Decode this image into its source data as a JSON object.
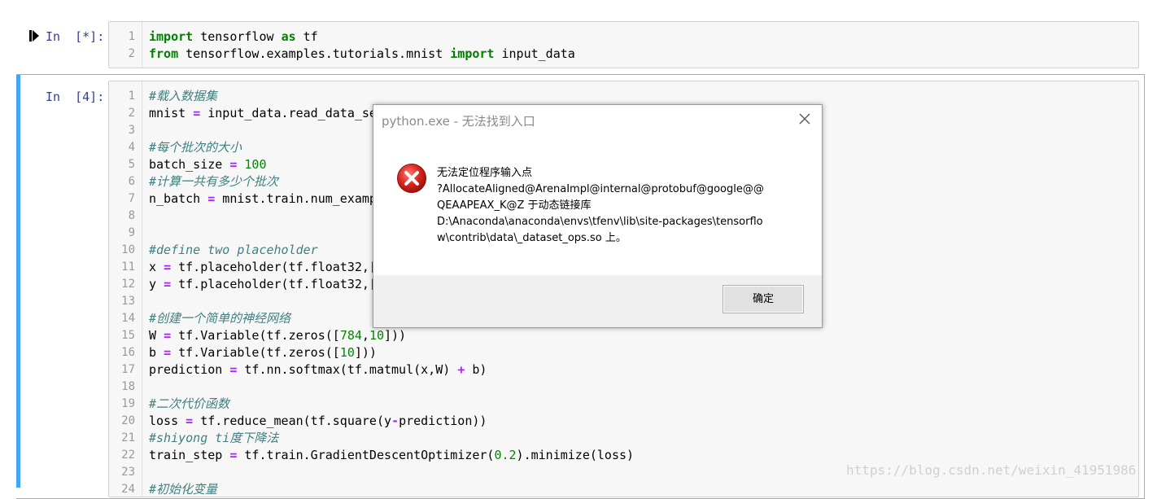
{
  "cell1": {
    "prompt": "In  [*]:",
    "lines": [
      {
        "n": "1",
        "parts": [
          {
            "t": "import",
            "c": "kw"
          },
          {
            "t": " tensorflow ",
            "c": ""
          },
          {
            "t": "as",
            "c": "kw"
          },
          {
            "t": " tf",
            "c": ""
          }
        ]
      },
      {
        "n": "2",
        "parts": [
          {
            "t": "from",
            "c": "kw"
          },
          {
            "t": " tensorflow.examples.tutorials.mnist ",
            "c": ""
          },
          {
            "t": "import",
            "c": "kw"
          },
          {
            "t": " input_data",
            "c": ""
          }
        ]
      }
    ]
  },
  "cell2": {
    "prompt": "In  [4]:",
    "lines": [
      {
        "n": "1",
        "parts": [
          {
            "t": "#载入数据集",
            "c": "cm"
          }
        ]
      },
      {
        "n": "2",
        "parts": [
          {
            "t": "mnist ",
            "c": ""
          },
          {
            "t": "=",
            "c": "op"
          },
          {
            "t": " input_data.read_data_set",
            "c": ""
          }
        ]
      },
      {
        "n": "3",
        "parts": []
      },
      {
        "n": "4",
        "parts": [
          {
            "t": "#每个批次的大小",
            "c": "cm"
          }
        ]
      },
      {
        "n": "5",
        "parts": [
          {
            "t": "batch_size ",
            "c": ""
          },
          {
            "t": "=",
            "c": "op"
          },
          {
            "t": " ",
            "c": ""
          },
          {
            "t": "100",
            "c": "nm"
          }
        ]
      },
      {
        "n": "6",
        "parts": [
          {
            "t": "#计算一共有多少个批次",
            "c": "cm"
          }
        ]
      },
      {
        "n": "7",
        "parts": [
          {
            "t": "n_batch ",
            "c": ""
          },
          {
            "t": "=",
            "c": "op"
          },
          {
            "t": " mnist.train.num_exampl",
            "c": ""
          }
        ]
      },
      {
        "n": "8",
        "parts": []
      },
      {
        "n": "9",
        "parts": []
      },
      {
        "n": "10",
        "parts": [
          {
            "t": "#define two placeholder",
            "c": "cm"
          }
        ]
      },
      {
        "n": "11",
        "parts": [
          {
            "t": "x ",
            "c": ""
          },
          {
            "t": "=",
            "c": "op"
          },
          {
            "t": " tf.placeholder(tf.float32,[N",
            "c": ""
          }
        ]
      },
      {
        "n": "12",
        "parts": [
          {
            "t": "y ",
            "c": ""
          },
          {
            "t": "=",
            "c": "op"
          },
          {
            "t": " tf.placeholder(tf.float32,[N",
            "c": ""
          }
        ]
      },
      {
        "n": "13",
        "parts": []
      },
      {
        "n": "14",
        "parts": [
          {
            "t": "#创建一个简单的神经网络",
            "c": "cm"
          }
        ]
      },
      {
        "n": "15",
        "parts": [
          {
            "t": "W ",
            "c": ""
          },
          {
            "t": "=",
            "c": "op"
          },
          {
            "t": " tf.Variable(tf.zeros([",
            "c": ""
          },
          {
            "t": "784",
            "c": "nm"
          },
          {
            "t": ",",
            "c": ""
          },
          {
            "t": "10",
            "c": "nm"
          },
          {
            "t": "]))",
            "c": ""
          }
        ]
      },
      {
        "n": "16",
        "parts": [
          {
            "t": "b ",
            "c": ""
          },
          {
            "t": "=",
            "c": "op"
          },
          {
            "t": " tf.Variable(tf.zeros([",
            "c": ""
          },
          {
            "t": "10",
            "c": "nm"
          },
          {
            "t": "]))",
            "c": ""
          }
        ]
      },
      {
        "n": "17",
        "parts": [
          {
            "t": "prediction ",
            "c": ""
          },
          {
            "t": "=",
            "c": "op"
          },
          {
            "t": " tf.nn.softmax(tf.matmul(x,W) ",
            "c": ""
          },
          {
            "t": "+",
            "c": "op"
          },
          {
            "t": " b)",
            "c": ""
          }
        ]
      },
      {
        "n": "18",
        "parts": []
      },
      {
        "n": "19",
        "parts": [
          {
            "t": "#二次代价函数",
            "c": "cm"
          }
        ]
      },
      {
        "n": "20",
        "parts": [
          {
            "t": "loss ",
            "c": ""
          },
          {
            "t": "=",
            "c": "op"
          },
          {
            "t": " tf.reduce_mean(tf.square(y",
            "c": ""
          },
          {
            "t": "-",
            "c": "op"
          },
          {
            "t": "prediction))",
            "c": ""
          }
        ]
      },
      {
        "n": "21",
        "parts": [
          {
            "t": "#shiyong ti度下降法",
            "c": "cm"
          }
        ]
      },
      {
        "n": "22",
        "parts": [
          {
            "t": "train_step ",
            "c": ""
          },
          {
            "t": "=",
            "c": "op"
          },
          {
            "t": " tf.train.GradientDescentOptimizer(",
            "c": ""
          },
          {
            "t": "0.2",
            "c": "nm"
          },
          {
            "t": ").minimize(loss)",
            "c": ""
          }
        ]
      },
      {
        "n": "23",
        "parts": []
      },
      {
        "n": "24",
        "parts": [
          {
            "t": "#初始化变量",
            "c": "cm"
          }
        ]
      }
    ]
  },
  "dialog": {
    "title": "python.exe - 无法找到入口",
    "icon": "error-icon",
    "message_lines": [
      "无法定位程序输入点",
      "?AllocateAligned@ArenaImpl@internal@protobuf@google@@",
      "QEAAPEAX_K@Z 于动态链接库",
      "D:\\Anaconda\\anaconda\\envs\\tfenv\\lib\\site-packages\\tensorflo",
      "w\\contrib\\data\\_dataset_ops.so 上。"
    ],
    "ok_label": "确定"
  },
  "watermark": "https://blog.csdn.net/weixin_41951986",
  "colors": {
    "selected_bar": "#42a5f5",
    "keyword": "#008000",
    "comment": "#408080",
    "number": "#008800",
    "operator": "#aa22ff"
  }
}
